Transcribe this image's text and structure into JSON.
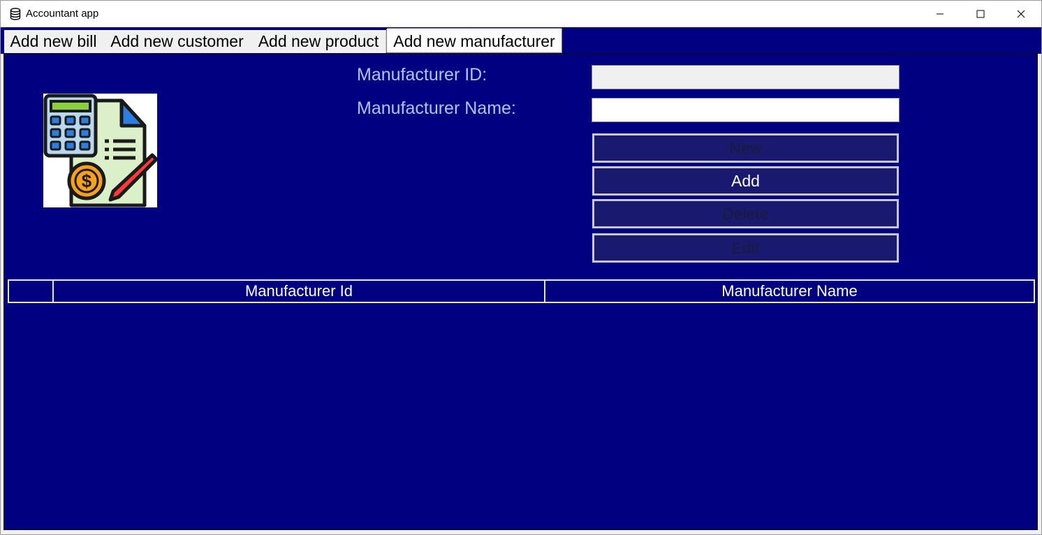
{
  "window": {
    "title": "Accountant app",
    "app_icon": "database-icon",
    "controls": [
      "minimize-icon",
      "maximize-icon",
      "close-icon"
    ]
  },
  "tabs": [
    {
      "label": "Add new bill",
      "active": false
    },
    {
      "label": "Add new customer",
      "active": false
    },
    {
      "label": "Add new product",
      "active": false
    },
    {
      "label": "Add new manufacturer",
      "active": true
    }
  ],
  "form": {
    "id_label": "Manufacturer ID:",
    "id_value": "",
    "name_label": "Manufacturer Name:",
    "name_value": ""
  },
  "buttons": {
    "new": {
      "label": "New",
      "enabled": false
    },
    "add": {
      "label": "Add",
      "enabled": true
    },
    "delete": {
      "label": "Delete",
      "enabled": false
    },
    "edit": {
      "label": "Edit",
      "enabled": false
    }
  },
  "grid": {
    "columns": [
      "",
      "Manufacturer Id",
      "Manufacturer Name"
    ],
    "rows": []
  },
  "colors": {
    "panel_background": "#000080",
    "label_text": "#a8c8ff",
    "button_background": "#191970"
  },
  "logo_icon": "calculator-invoice-icon"
}
